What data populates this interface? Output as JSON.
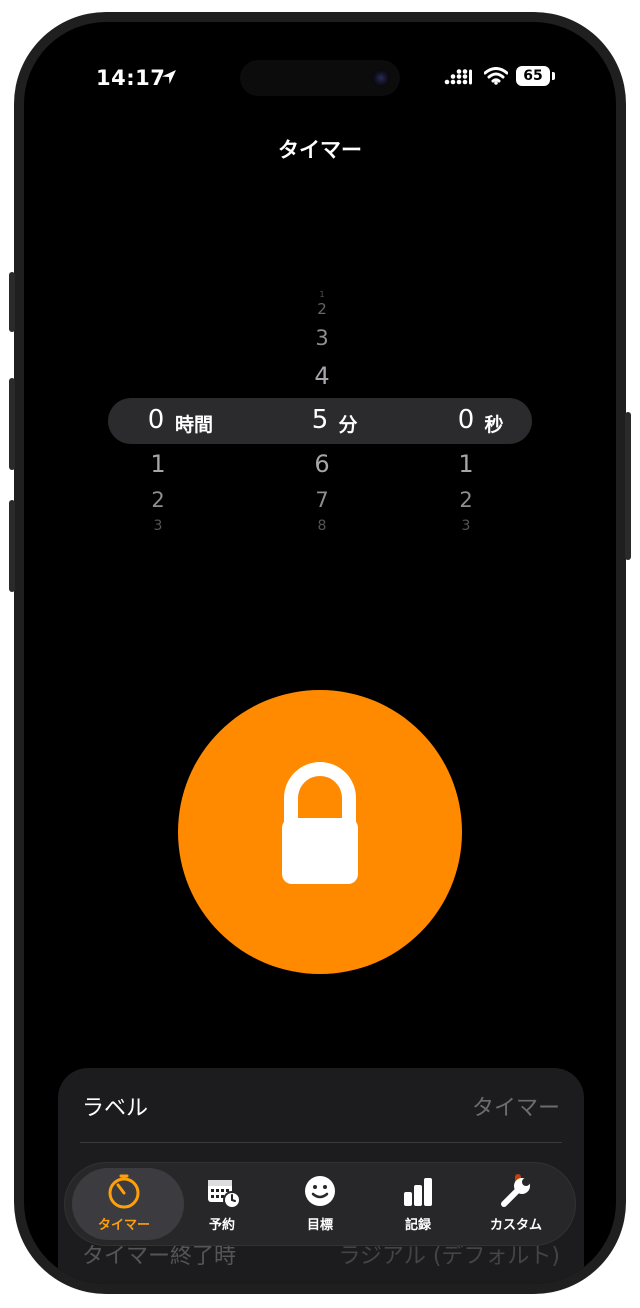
{
  "status_bar": {
    "time": "14:17",
    "battery": "65"
  },
  "header": {
    "title": "タイマー"
  },
  "picker": {
    "hours": {
      "value": "0",
      "unit": "時間",
      "below": [
        "1",
        "2",
        "3"
      ]
    },
    "minutes": {
      "value": "5",
      "unit": "分",
      "above": [
        "1",
        "2",
        "3",
        "4"
      ],
      "below": [
        "6",
        "7",
        "8"
      ]
    },
    "seconds": {
      "value": "0",
      "unit": "秒",
      "below": [
        "1",
        "2",
        "3"
      ]
    }
  },
  "main_button": {
    "icon": "lock-icon",
    "color": "#ff8a00"
  },
  "settings_card": {
    "label_row": {
      "label": "ラベル",
      "value": "タイマー"
    },
    "end_row": {
      "label": "タイマー終了時",
      "value": "ラジアル (デフォルト)"
    }
  },
  "tab_bar": {
    "items": [
      {
        "label": "タイマー",
        "icon": "timer-icon",
        "active": true
      },
      {
        "label": "予約",
        "icon": "calendar-icon",
        "active": false
      },
      {
        "label": "目標",
        "icon": "smiley-icon",
        "active": false
      },
      {
        "label": "記録",
        "icon": "bar-chart-icon",
        "active": false
      },
      {
        "label": "カスタム",
        "icon": "wrench-icon",
        "active": false
      }
    ]
  },
  "colors": {
    "accent": "#ff9f0a",
    "button": "#ff8a00",
    "background": "#000000"
  }
}
